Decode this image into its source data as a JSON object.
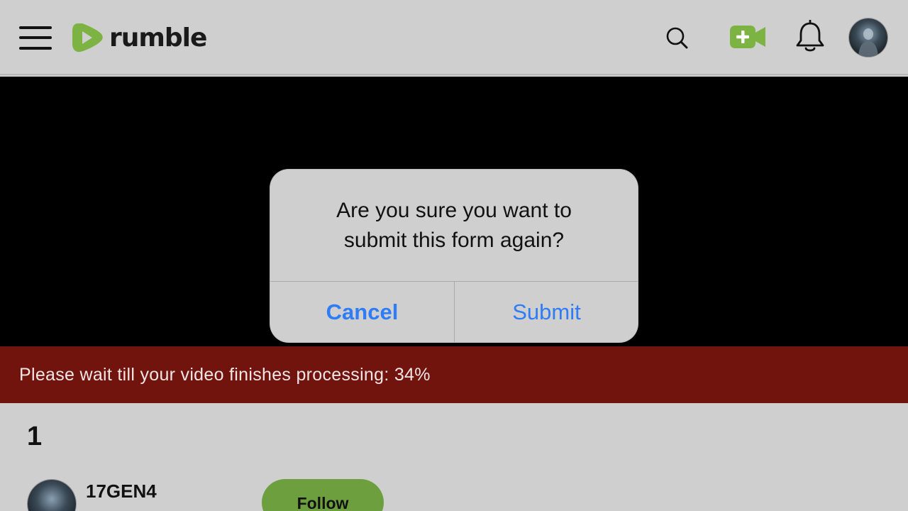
{
  "header": {
    "logo_text": "rumble",
    "brand_color": "#7cb342",
    "icons": [
      "menu-icon",
      "search-icon",
      "upload-video-icon",
      "bell-icon",
      "avatar"
    ]
  },
  "dialog": {
    "message": "Are you sure you want to submit this form again?",
    "cancel_label": "Cancel",
    "submit_label": "Submit",
    "button_color": "#2e7cf6"
  },
  "banner": {
    "text": "Please wait till your video finishes processing: 34%",
    "progress_percent": 34,
    "background_color": "#72140e"
  },
  "video": {
    "title": "1",
    "channel_name": "17GEN4",
    "follow_label": "Follow",
    "follow_color": "#6e9f3f"
  }
}
